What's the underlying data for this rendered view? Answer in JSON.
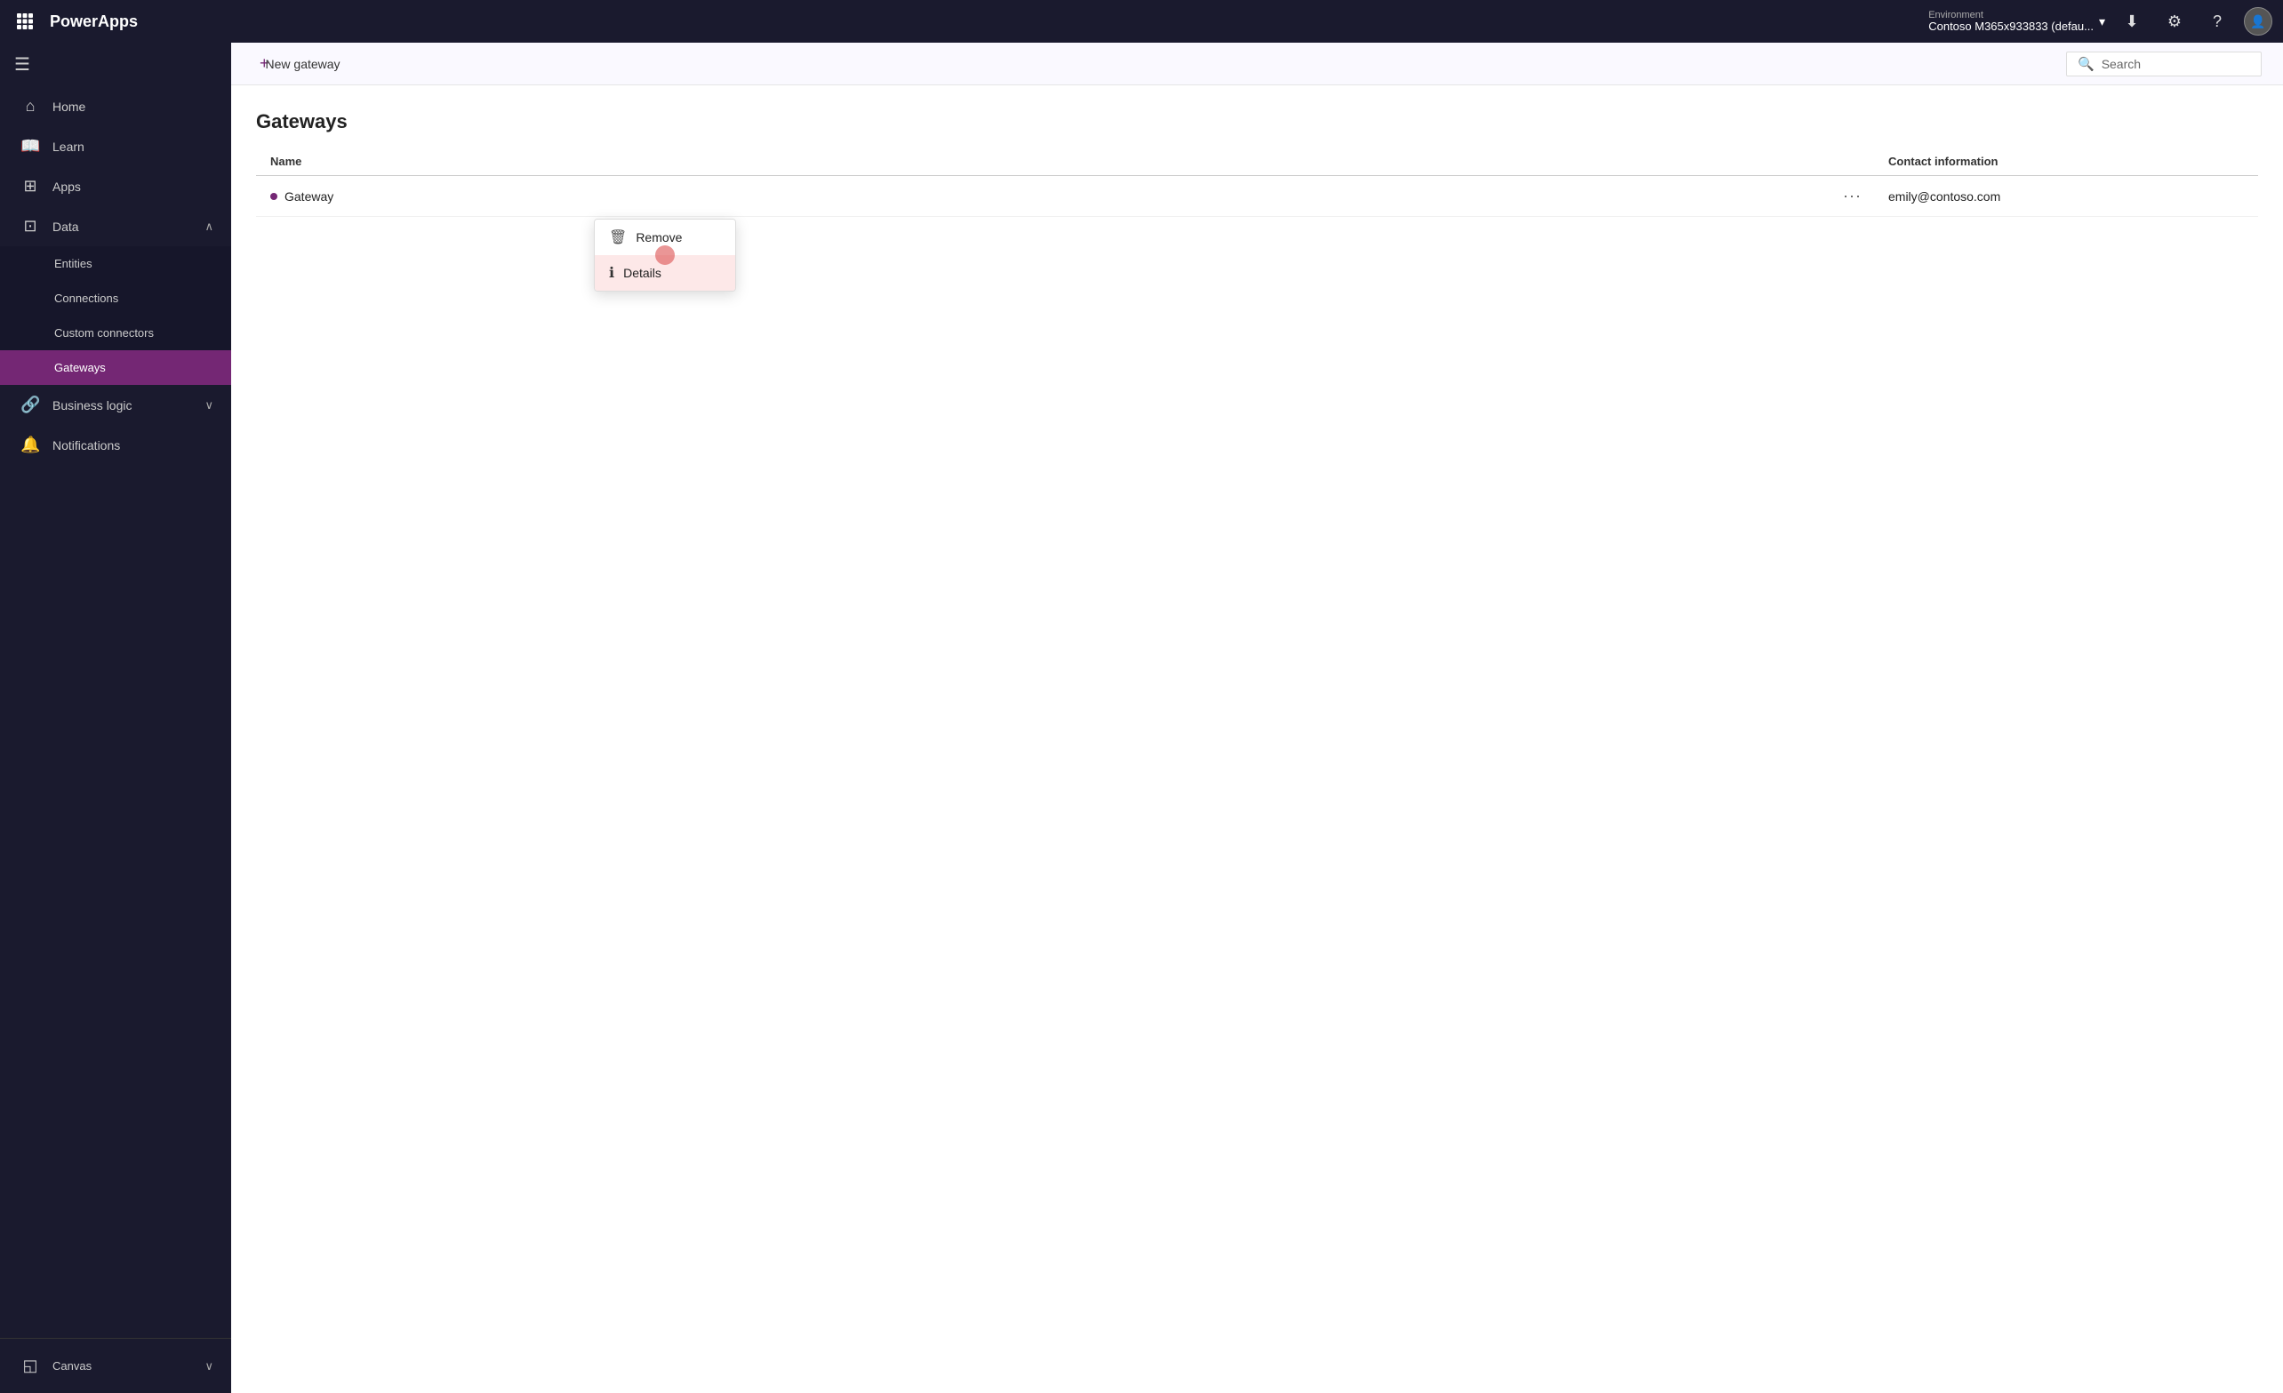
{
  "topbar": {
    "app_name": "PowerApps",
    "environment_label": "Environment",
    "environment_name": "Contoso M365x933833 (defau...",
    "search_placeholder": "Search"
  },
  "sidebar": {
    "toggle_icon": "☰",
    "items": [
      {
        "id": "home",
        "label": "Home",
        "icon": "⌂",
        "active": false
      },
      {
        "id": "learn",
        "label": "Learn",
        "icon": "📖",
        "active": false
      },
      {
        "id": "apps",
        "label": "Apps",
        "icon": "⊞",
        "active": false
      },
      {
        "id": "data",
        "label": "Data",
        "icon": "⊡",
        "active": false,
        "expanded": true,
        "chevron": "∧"
      }
    ],
    "data_sub": [
      {
        "id": "entities",
        "label": "Entities",
        "active": false
      },
      {
        "id": "connections",
        "label": "Connections",
        "active": false
      },
      {
        "id": "custom-connectors",
        "label": "Custom connectors",
        "active": false
      },
      {
        "id": "gateways",
        "label": "Gateways",
        "active": true
      }
    ],
    "bottom_items": [
      {
        "id": "business-logic",
        "label": "Business logic",
        "icon": "🔗",
        "active": false,
        "chevron": "∨"
      },
      {
        "id": "notifications",
        "label": "Notifications",
        "icon": "🔔",
        "active": false
      }
    ],
    "footer": [
      {
        "id": "canvas",
        "label": "Canvas",
        "icon": "◱",
        "active": false
      }
    ]
  },
  "toolbar": {
    "new_gateway_label": "+ New gateway",
    "search_label": "Search"
  },
  "page": {
    "title": "Gateways",
    "table": {
      "col_name": "Name",
      "col_contact": "Contact information",
      "rows": [
        {
          "name": "Gateway",
          "contact": "emily@contoso.com"
        }
      ]
    },
    "dropdown": {
      "items": [
        {
          "id": "remove",
          "label": "Remove",
          "icon": "🗑"
        },
        {
          "id": "details",
          "label": "Details",
          "icon": "ℹ",
          "highlighted": true
        }
      ]
    }
  }
}
